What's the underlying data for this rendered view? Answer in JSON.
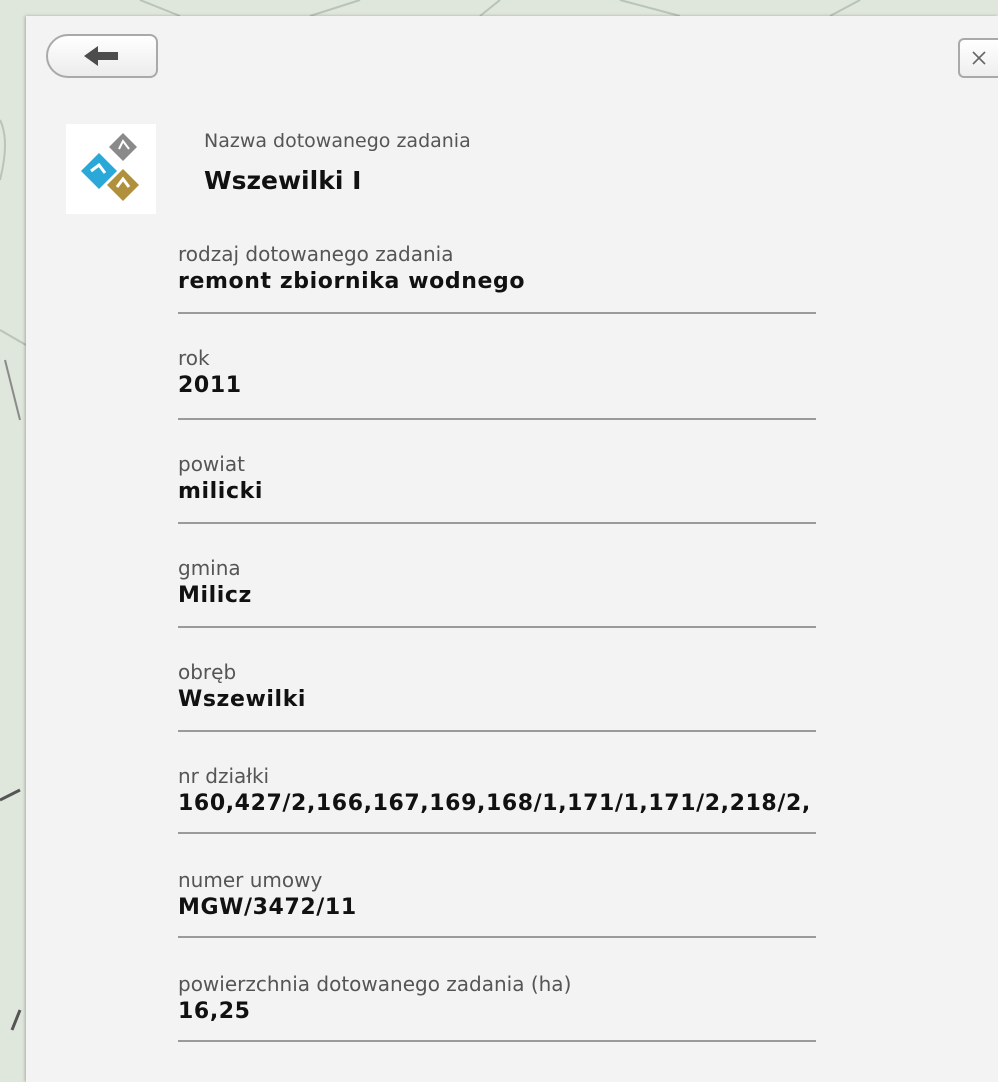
{
  "window": {
    "back_icon": "back-arrow-icon",
    "close_icon": "close-x-icon"
  },
  "header": {
    "label": "Nazwa dotowanego zadania",
    "title": "Wszewilki I"
  },
  "fields": [
    {
      "label": "rodzaj dotowanego zadania",
      "value": "remont zbiornika wodnego"
    },
    {
      "label": "rok",
      "value": "2011"
    },
    {
      "label": "powiat",
      "value": "milicki"
    },
    {
      "label": "gmina",
      "value": "Milicz"
    },
    {
      "label": "obręb",
      "value": "Wszewilki"
    },
    {
      "label": "nr działki",
      "value": "160,427/2,166,167,169,168/1,171/1,171/2,218/2,"
    },
    {
      "label": "numer umowy",
      "value": "MGW/3472/11"
    },
    {
      "label": "powierzchnia dotowanego zadania (ha)",
      "value": "16,25"
    }
  ],
  "colors": {
    "logo_grey": "#8a8a8a",
    "logo_blue": "#2aa8d8",
    "logo_gold": "#b0903c",
    "panel_bg": "#f3f3f3",
    "divider": "#9a9a9a"
  }
}
